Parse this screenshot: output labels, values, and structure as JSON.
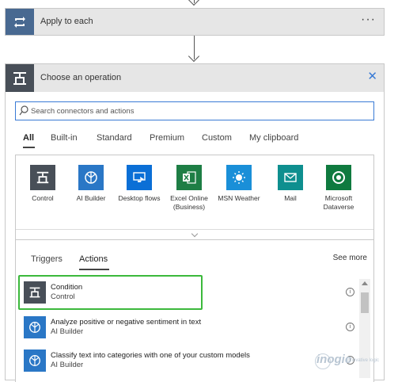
{
  "apply_card": {
    "title": "Apply to each",
    "more_label": "···",
    "icon": "loop-icon"
  },
  "operation_card": {
    "title": "Choose an operation",
    "close_label": "✕",
    "icon": "control-icon"
  },
  "search": {
    "placeholder": "Search connectors and actions"
  },
  "tabs": [
    "All",
    "Built-in",
    "Standard",
    "Premium",
    "Custom",
    "My clipboard"
  ],
  "active_tab": "All",
  "connectors": [
    {
      "label": "Control",
      "color": "#484f58",
      "icon": "control-icon"
    },
    {
      "label": "AI Builder",
      "color": "#2a77c6",
      "icon": "ai-builder-icon"
    },
    {
      "label": "Desktop flows",
      "color": "#0b6fd6",
      "icon": "desktop-flows-icon"
    },
    {
      "label": "Excel Online (Business)",
      "color": "#1e7e45",
      "icon": "excel-icon"
    },
    {
      "label": "MSN Weather",
      "color": "#1a8fd8",
      "icon": "weather-icon"
    },
    {
      "label": "Mail",
      "color": "#0e8f8f",
      "icon": "mail-icon"
    },
    {
      "label": "Microsoft Dataverse",
      "color": "#0f7a3f",
      "icon": "dataverse-icon"
    }
  ],
  "sub_tabs": [
    "Triggers",
    "Actions"
  ],
  "active_sub_tab": "Actions",
  "see_more_label": "See more",
  "actions": [
    {
      "title": "Condition",
      "subtitle": "Control",
      "color": "#484f58",
      "icon": "control-icon"
    },
    {
      "title": "Analyze positive or negative sentiment in text",
      "subtitle": "AI Builder",
      "color": "#2a77c6",
      "icon": "ai-builder-icon"
    },
    {
      "title": "Classify text into categories with one of your custom models",
      "subtitle": "AI Builder",
      "color": "#2a77c6",
      "icon": "ai-builder-icon"
    }
  ],
  "info_glyph": "i",
  "watermark": {
    "brand": "inogic",
    "tagline": "innovative logic"
  }
}
